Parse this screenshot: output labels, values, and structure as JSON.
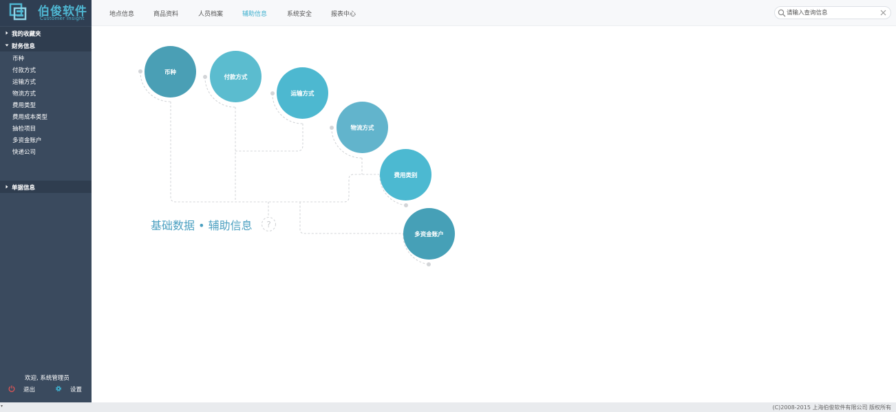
{
  "brand": {
    "name_cn": "伯俊软件",
    "name_en": "Customer Insight",
    "color": "#4fb7d2"
  },
  "nav": {
    "items": [
      {
        "label": "地点信息"
      },
      {
        "label": "商品资料"
      },
      {
        "label": "人员档案"
      },
      {
        "label": "辅助信息",
        "active": true
      },
      {
        "label": "系统安全"
      },
      {
        "label": "报表中心"
      }
    ],
    "active_color": "#3fb0cf"
  },
  "search": {
    "placeholder": "请输入查询信息",
    "value": "",
    "icon": "search-icon",
    "clear_icon": "close-icon"
  },
  "sidebar": {
    "sections": [
      {
        "label": "我的收藏夹",
        "expanded": false
      },
      {
        "label": "财务信息",
        "expanded": true,
        "items": [
          "币种",
          "付款方式",
          "运输方式",
          "物流方式",
          "费用类型",
          "费用成本类型",
          "抽检项目",
          "多资金账户",
          "快递公司"
        ]
      },
      {
        "label": "单据信息",
        "expanded": false
      }
    ],
    "welcome": "欢迎, 系统管理员",
    "logout_label": "退出",
    "settings_label": "设置"
  },
  "diagram": {
    "title": "基础数据 • 辅助信息",
    "help_icon": "question-icon",
    "nodes": [
      {
        "label": "币种",
        "color": "#4a9fb5"
      },
      {
        "label": "付款方式",
        "color": "#5bbccf"
      },
      {
        "label": "运输方式",
        "color": "#4db8d0"
      },
      {
        "label": "物流方式",
        "color": "#62b4cc"
      },
      {
        "label": "费用类别",
        "color": "#4cb9d1"
      },
      {
        "label": "多资金账户",
        "color": "#46a0b7"
      }
    ]
  },
  "footer": {
    "copyright": "(C)2008-2015 上海伯俊软件有限公司 版权所有"
  }
}
